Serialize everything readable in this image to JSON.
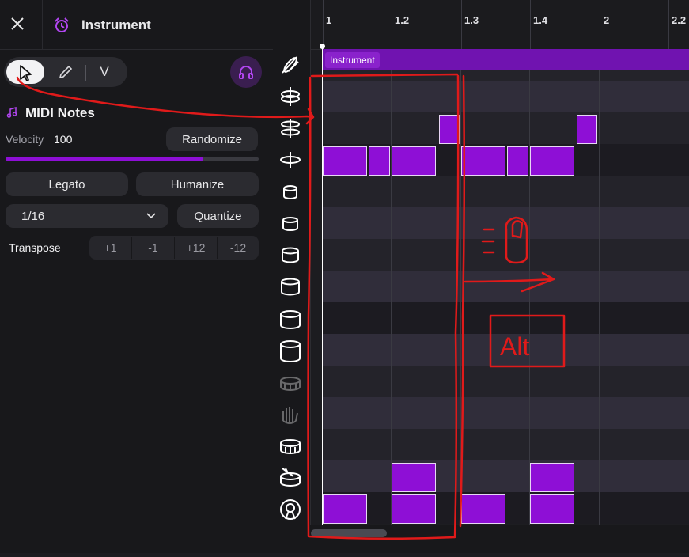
{
  "header": {
    "title": "Instrument",
    "close_icon": "close-icon",
    "instrument_icon": "alarm-clock-icon"
  },
  "toolbar": {
    "tools": [
      "pointer-icon",
      "pencil-icon",
      "velocity-icon"
    ],
    "velocity_tool_label": "V",
    "listen_icon": "headphones-icon"
  },
  "midi": {
    "title": "MIDI Notes",
    "velocity_label": "Velocity",
    "velocity_value": "100",
    "velocity_fraction": 0.78,
    "randomize_label": "Randomize",
    "legato_label": "Legato",
    "humanize_label": "Humanize",
    "grid_value": "1/16",
    "quantize_label": "Quantize",
    "transpose_label": "Transpose",
    "transpose_options": [
      "+1",
      "-1",
      "+12",
      "-12"
    ]
  },
  "timeline": {
    "ticks": [
      "1",
      "1.2",
      "1.3",
      "1.4",
      "2",
      "2.2"
    ],
    "clip_label": "Instrument"
  },
  "drum_rows": [
    "crash-cymbal-icon",
    "hihat-closed-icon",
    "hihat-open-icon",
    "ride-cymbal-icon",
    "tom-1-icon",
    "tom-2-icon",
    "tom-3-icon",
    "tom-4-icon",
    "floor-tom-1-icon",
    "floor-tom-2-icon",
    "rimshot-icon",
    "hand-clap-icon",
    "snare-icon",
    "snare-stick-icon",
    "kick-drum-icon"
  ],
  "annotations": {
    "handwritten_text": "Alt"
  },
  "colors": {
    "accent": "#8e0fd6",
    "annotation": "#e01a1a",
    "clip": "#7013b0"
  }
}
